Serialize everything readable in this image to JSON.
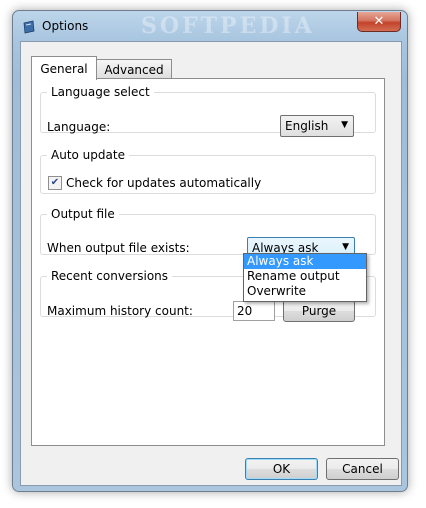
{
  "window": {
    "title": "Options",
    "watermark": "SOFTPEDIA",
    "close_glyph": "✕"
  },
  "tabs": [
    {
      "label": "General",
      "active": true
    },
    {
      "label": "Advanced",
      "active": false
    }
  ],
  "groups": {
    "language": {
      "legend": "Language select",
      "label": "Language:",
      "value": "English"
    },
    "auto_update": {
      "legend": "Auto update",
      "checkbox_label": "Check for updates automatically",
      "checked": true
    },
    "output_file": {
      "legend": "Output file",
      "label": "When output file exists:",
      "value": "Always ask",
      "options": [
        "Always ask",
        "Rename output",
        "Overwrite"
      ]
    },
    "recent": {
      "legend": "Recent conversions",
      "label": "Maximum history count:",
      "count": "20",
      "purge_label": "Purge"
    }
  },
  "footer": {
    "ok_label": "OK",
    "cancel_label": "Cancel"
  },
  "colors": {
    "selection": "#3399ff",
    "close": "#c7432b",
    "frame": "#a9c6e0"
  },
  "icons": {
    "app": "options-app-icon",
    "dropdown": "chevron-down-icon",
    "check": "checkmark-icon"
  }
}
